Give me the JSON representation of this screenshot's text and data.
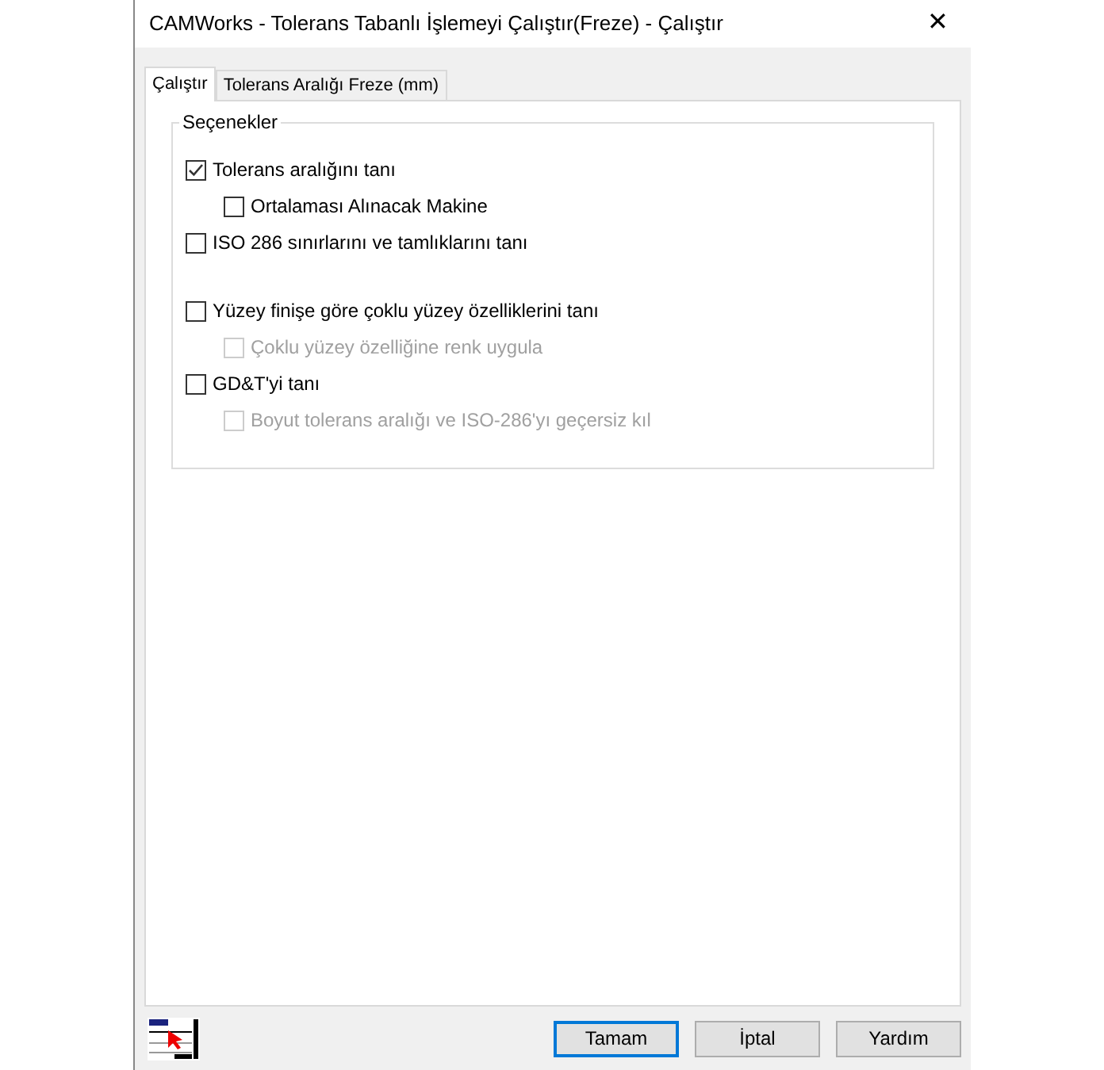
{
  "window": {
    "title": "CAMWorks - Tolerans Tabanlı İşlemeyi Çalıştır(Freze) - Çalıştır",
    "close": "✕"
  },
  "tabs": [
    {
      "label": "Çalıştır",
      "selected": true
    },
    {
      "label": "Tolerans Aralığı Freze (mm)",
      "selected": false
    }
  ],
  "group": {
    "title": "Seçenekler",
    "options": [
      {
        "label": "Tolerans aralığını tanı",
        "checked": true,
        "disabled": false,
        "children": [
          {
            "label": "Ortalaması Alınacak Makine",
            "checked": false,
            "disabled": false
          }
        ]
      },
      {
        "label": "ISO 286 sınırlarını ve tamlıklarını tanı",
        "checked": false,
        "disabled": false
      },
      {
        "label": "Yüzey finişe göre çoklu yüzey özelliklerini tanı",
        "checked": false,
        "disabled": false,
        "children": [
          {
            "label": "Çoklu yüzey özelliğine renk uygula",
            "checked": false,
            "disabled": true
          }
        ]
      },
      {
        "label": "GD&T'yi tanı",
        "checked": false,
        "disabled": false,
        "children": [
          {
            "label": "Boyut tolerans aralığı ve ISO-286'yı geçersiz kıl",
            "checked": false,
            "disabled": true
          }
        ]
      }
    ]
  },
  "buttons": [
    {
      "label": "Tamam",
      "default": true
    },
    {
      "label": "İptal",
      "default": false
    },
    {
      "label": "Yardım",
      "default": false
    }
  ]
}
